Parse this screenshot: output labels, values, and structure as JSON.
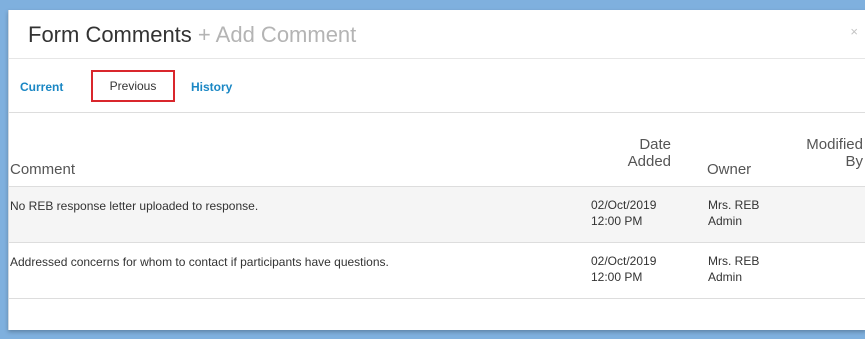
{
  "dialog": {
    "title": "Form Comments",
    "add_comment": "+ Add Comment",
    "close_glyph": "×"
  },
  "tabs": {
    "current": "Current",
    "previous": "Previous",
    "history": "History"
  },
  "table": {
    "headers": {
      "comment": "Comment",
      "date_line1": "Date",
      "date_line2": "Added",
      "owner": "Owner",
      "modified_line1": "Modified",
      "modified_line2": "By"
    },
    "rows": [
      {
        "comment": "No REB response letter uploaded to response.",
        "date": "02/Oct/2019",
        "time": "12:00 PM",
        "owner_line1": "Mrs. REB",
        "owner_line2": "Admin",
        "modified_by": ""
      },
      {
        "comment": "Addressed concerns for whom to contact if participants have questions.",
        "date": "02/Oct/2019",
        "time": "12:00 PM",
        "owner_line1": "Mrs. REB",
        "owner_line2": "Admin",
        "modified_by": ""
      }
    ]
  },
  "colors": {
    "link": "#1a87c4",
    "highlight_border": "#d9262c",
    "row_stripe": "#f5f5f5",
    "background": "#7fb0de"
  }
}
